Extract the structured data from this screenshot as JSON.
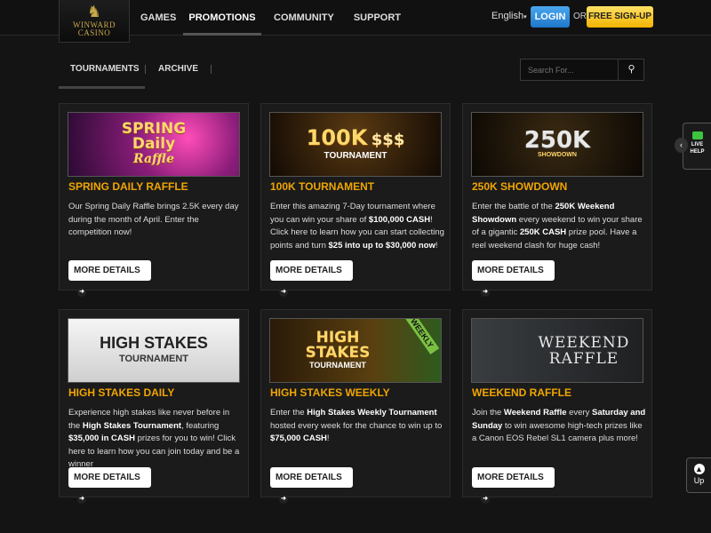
{
  "header": {
    "logo_text": "WINWARD CASINO",
    "nav": [
      "GAMES",
      "PROMOTIONS",
      "COMMUNITY",
      "SUPPORT"
    ],
    "language": "English",
    "login_label": "LOGIN",
    "or_label": "OR",
    "signup_label": "FREE SIGN-UP"
  },
  "subnav": {
    "tabs": [
      "TOURNAMENTS",
      "ARCHIVE"
    ],
    "search_placeholder": "Search For..."
  },
  "cards": [
    {
      "banner": {
        "line1": "SPRING",
        "line2": "Daily",
        "line3": "Raffle"
      },
      "title": "SPRING DAILY RAFFLE",
      "desc": "Our Spring Daily Raffle brings 2.5K every day during the month of April. Enter the competition now!",
      "button": "MORE DETAILS"
    },
    {
      "banner": {
        "line1": "100K",
        "line2": "TOURNAMENT",
        "line3": "$$$"
      },
      "title": "100K TOURNAMENT",
      "desc_parts": [
        "Enter this amazing 7-Day tournament where you can win your share of ",
        "$100,000 CASH",
        "! Click here to learn how you can start collecting points and turn ",
        "$25 into up to $30,000 now",
        "!"
      ],
      "button": "MORE DETAILS"
    },
    {
      "banner": {
        "line1": "250K",
        "line2": "SHOWDOWN"
      },
      "title": "250K SHOWDOWN",
      "desc_parts": [
        "Enter the battle of the ",
        "250K Weekend Showdown",
        " every weekend to win your share of a gigantic ",
        "250K CASH",
        " prize pool. Have a reel weekend clash for huge cash!"
      ],
      "button": "MORE DETAILS"
    },
    {
      "banner": {
        "line1": "HIGH STAKES",
        "line2": "TOURNAMENT"
      },
      "title": "HIGH STAKES DAILY",
      "desc_parts": [
        "Experience high stakes like never before in the ",
        "High Stakes Tournament",
        ", featuring ",
        "$35,000 in CASH",
        " prizes for you to win! Click here to learn how you can join today and be a winner"
      ],
      "button": "MORE DETAILS"
    },
    {
      "banner": {
        "line1": "HIGH",
        "line2": "STAKES",
        "line3": "TOURNAMENT",
        "tag": "WEEKLY"
      },
      "title": "HIGH STAKES WEEKLY",
      "desc_parts": [
        "Enter the ",
        "High Stakes Weekly Tournament",
        " hosted every week for the chance to win up to ",
        "$75,000 CASH",
        "!"
      ],
      "button": "MORE DETAILS"
    },
    {
      "banner": {
        "line1": "WEEKEND",
        "line2": "RAFFLE"
      },
      "title": "WEEKEND RAFFLE",
      "desc_parts": [
        "Join the ",
        "Weekend Raffle",
        " every ",
        "Saturday and Sunday",
        " to win awesome high-tech prizes like a Canon EOS Rebel SL1 camera plus more!"
      ],
      "button": "MORE DETAILS"
    }
  ],
  "live_help": {
    "line1": "LIVE",
    "line2": "HELP"
  },
  "up_label": "Up"
}
